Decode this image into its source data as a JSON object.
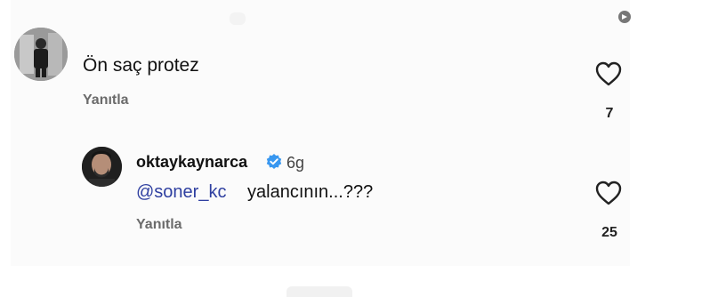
{
  "comments": [
    {
      "text": "Ön saç protez",
      "reply_label": "Yanıtla",
      "likes": "7"
    }
  ],
  "reply": {
    "username": "oktaykaynarca",
    "verified": true,
    "age": "6g",
    "mention": "@soner_kc",
    "text": "yalancının...???",
    "reply_label": "Yanıtla",
    "likes": "25"
  },
  "colors": {
    "mention": "#2e3fa0",
    "verified_badge": "#3897f0",
    "secondary_text": "#6b6b6b"
  },
  "icons": [
    "heart-icon",
    "verified-badge-icon",
    "share-icon"
  ]
}
